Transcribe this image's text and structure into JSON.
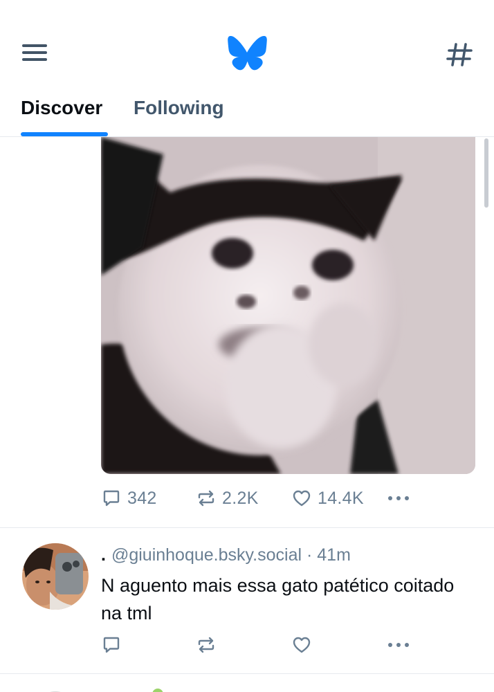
{
  "header": {
    "menu_icon": "hamburger-menu-icon",
    "logo_icon": "butterfly-logo-icon",
    "feeds_icon": "hashtag-icon",
    "brand_color": "#1083fe"
  },
  "tabs": [
    {
      "label": "Discover",
      "active": true
    },
    {
      "label": "Following",
      "active": false
    }
  ],
  "posts": [
    {
      "media": {
        "kind": "image",
        "subject": "cat-photo"
      },
      "stats": {
        "replies": "342",
        "reposts": "2.2K",
        "likes": "14.4K"
      },
      "icons": [
        "reply-icon",
        "repost-icon",
        "like-icon",
        "more-icon"
      ]
    },
    {
      "lead_glyph": ".",
      "handle": "@giuinhoque.bsky.social",
      "separator": "·",
      "time": "41m",
      "text": "N aguento mais essa gato patético coitado na tml",
      "stats": {
        "replies": "",
        "reposts": "",
        "likes": ""
      }
    }
  ],
  "colors": {
    "muted": "#6a7f93",
    "icon": "#42576c",
    "divider": "#e6e9ee"
  }
}
